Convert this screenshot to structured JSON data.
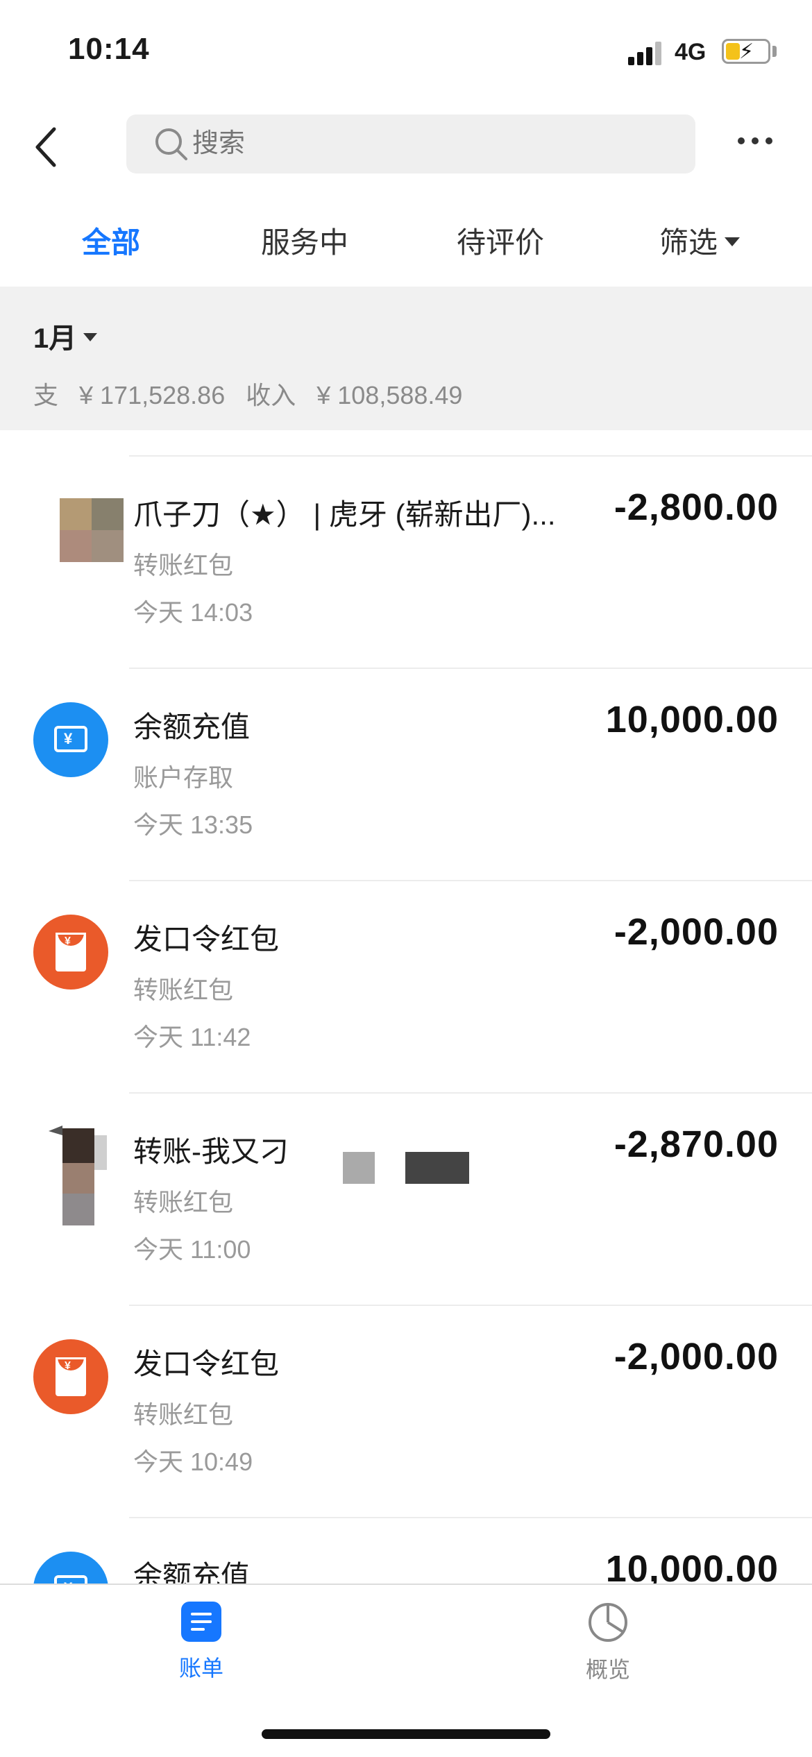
{
  "status_bar": {
    "time": "10:14",
    "network": "4G"
  },
  "nav": {
    "search_placeholder": "搜索"
  },
  "tabs": [
    {
      "label": "全部",
      "active": true
    },
    {
      "label": "服务中",
      "active": false
    },
    {
      "label": "待评价",
      "active": false
    },
    {
      "label": "筛选",
      "active": false
    }
  ],
  "summary": {
    "month": "1月",
    "expense_label": "支",
    "expense": "¥ 171,528.86",
    "income_label": "收入",
    "income": "¥ 108,588.49"
  },
  "transactions": [
    {
      "title": "爪子刀（★） | 虎牙 (崭新出厂)...",
      "category": "转账红包",
      "time": "今天  14:03",
      "amount": "-2,800.00",
      "icon": "mosaic-avatar"
    },
    {
      "title": "余额充值",
      "category": "账户存取",
      "time": "今天  13:35",
      "amount": "10,000.00",
      "icon": "balance-card-icon"
    },
    {
      "title": "发口令红包",
      "category": "转账红包",
      "time": "今天  11:42",
      "amount": "-2,000.00",
      "icon": "red-packet-icon"
    },
    {
      "title": "转账-我又刁",
      "category": "转账红包",
      "time": "今天  11:00",
      "amount": "-2,870.00",
      "icon": "person-avatar"
    },
    {
      "title": "发口令红包",
      "category": "转账红包",
      "time": "今天  10:49",
      "amount": "-2,000.00",
      "icon": "red-packet-icon"
    },
    {
      "title": "余额充值",
      "category": "",
      "time": "",
      "amount": "10,000.00",
      "icon": "balance-card-icon"
    }
  ],
  "tabbar": [
    {
      "label": "账单",
      "active": true,
      "icon": "bill-icon"
    },
    {
      "label": "概览",
      "active": false,
      "icon": "pie-chart-icon"
    }
  ],
  "colors": {
    "accent": "#1677ff",
    "recharge_blue": "#1c8ff2",
    "red_packet": "#ea5a2a",
    "summary_bg": "#f1f1f1"
  }
}
